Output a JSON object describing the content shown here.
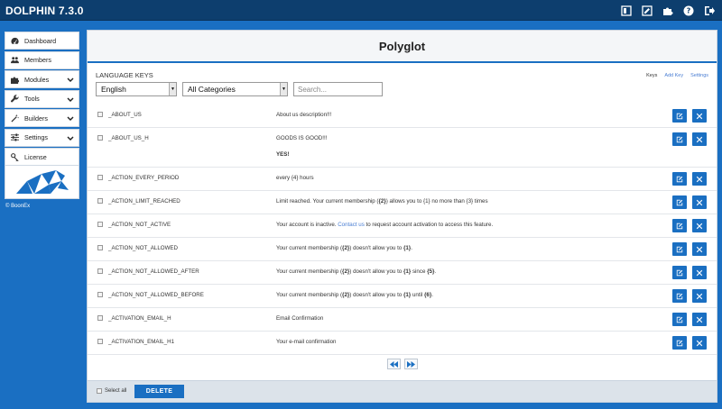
{
  "app": {
    "title": "DOLPHIN 7.3.0",
    "copyright": "© BoonEx"
  },
  "colors": {
    "accent": "#1a6fc2",
    "topbar": "#0d3e6e",
    "link": "#4a7ed3"
  },
  "top_icons": [
    "grid-icon",
    "edit-icon",
    "puzzle-icon",
    "help-icon",
    "logout-icon"
  ],
  "sidebar": {
    "items": [
      {
        "label": "Dashboard",
        "icon": "dashboard-icon",
        "expandable": false
      },
      {
        "label": "Members",
        "icon": "users-icon",
        "expandable": false
      },
      {
        "label": "Modules",
        "icon": "puzzle-icon",
        "expandable": true
      },
      {
        "label": "Tools",
        "icon": "wrench-icon",
        "expandable": true
      },
      {
        "label": "Builders",
        "icon": "magic-icon",
        "expandable": true
      },
      {
        "label": "Settings",
        "icon": "sliders-icon",
        "expandable": true
      },
      {
        "label": "License",
        "icon": "key-icon",
        "expandable": false
      }
    ]
  },
  "page": {
    "title": "Polyglot",
    "section_label": "LANGUAGE KEYS",
    "links": {
      "keys": "Keys",
      "add_key": "Add Key",
      "settings": "Settings"
    },
    "filters": {
      "language": "English",
      "category": "All Categories",
      "search_placeholder": "Search..."
    }
  },
  "rows": [
    {
      "key": "_ABOUT_US",
      "value": "About us description!!!"
    },
    {
      "key": "_ABOUT_US_H",
      "value": "GOODS IS GOOD!!!",
      "extra": "YES!"
    },
    {
      "key": "_ACTION_EVERY_PERIOD",
      "value": "every {4} hours"
    },
    {
      "key": "_ACTION_LIMIT_REACHED",
      "value_parts": [
        "Limit reached. Your current membership (",
        "{2}",
        ") allows you to {1} no more than {3} times"
      ]
    },
    {
      "key": "_ACTION_NOT_ACTIVE",
      "value_parts": [
        "Your account is inactive. ",
        "Contact us",
        " to request account activation to access this feature."
      ]
    },
    {
      "key": "_ACTION_NOT_ALLOWED",
      "value_parts": [
        "Your current membership (",
        "{2}",
        ") doesn't allow you to ",
        "{1}",
        "."
      ]
    },
    {
      "key": "_ACTION_NOT_ALLOWED_AFTER",
      "value_parts": [
        "Your current membership (",
        "{2}",
        ") doesn't allow you to ",
        "{1}",
        " since ",
        "{5}",
        "."
      ]
    },
    {
      "key": "_ACTION_NOT_ALLOWED_BEFORE",
      "value_parts": [
        "Your current membership (",
        "{2}",
        ") doesn't allow you to ",
        "{1}",
        " until ",
        "{6}",
        "."
      ]
    },
    {
      "key": "_ACTIVATION_EMAIL_H",
      "value": "Email Confirmation"
    },
    {
      "key": "_ACTIVATION_EMAIL_H1",
      "value": "Your e-mail confirmation"
    }
  ],
  "footer": {
    "select_all": "Select all",
    "delete_label": "DELETE"
  }
}
